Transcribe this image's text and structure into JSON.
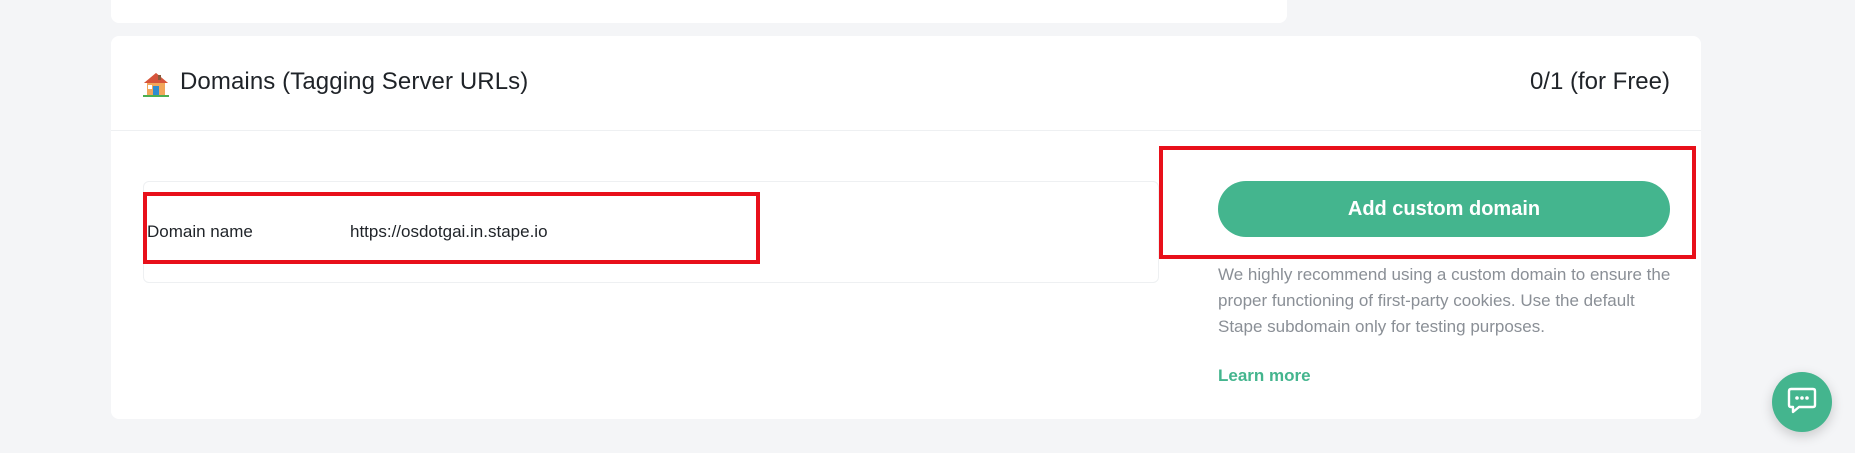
{
  "domains_section": {
    "title": "Domains (Tagging Server URLs)",
    "title_icon": "house-icon",
    "plan_usage": "0/1 (for Free)",
    "domain_row": {
      "label": "Domain name",
      "value": "https://osdotgai.in.stape.io"
    },
    "add_button_label": "Add custom domain",
    "helper_text": "We highly recommend using a custom domain to ensure the proper functioning of first-party cookies. Use the default Stape subdomain only for testing purposes.",
    "learn_more_label": "Learn more"
  },
  "chat_widget": {
    "icon": "chat-bubble-icon"
  },
  "colors": {
    "accent": "#44b58e",
    "highlight": "#e8101a",
    "page_background": "#f4f5f7"
  }
}
